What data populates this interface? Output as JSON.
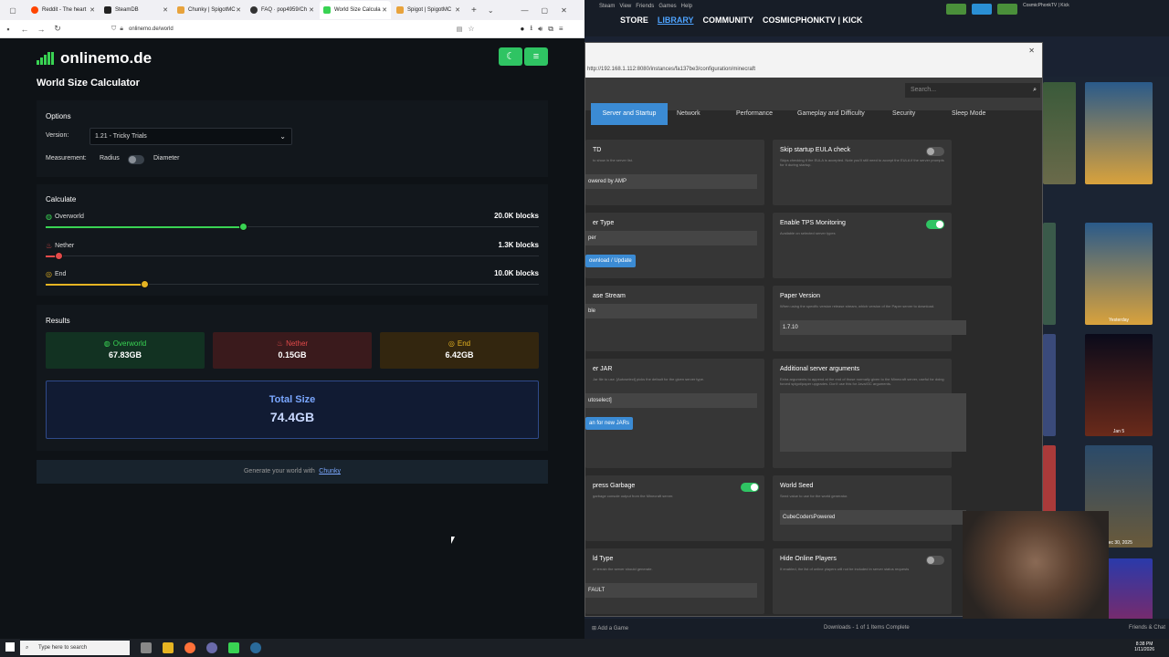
{
  "browser": {
    "tabs": [
      {
        "label": "Reddit - The heart",
        "color": "#ff4500"
      },
      {
        "label": "SteamDB",
        "color": "#222222"
      },
      {
        "label": "Chunky | SpigotMC",
        "color": "#e8a33c"
      },
      {
        "label": "FAQ · pop4959/Ch",
        "color": "#333333"
      },
      {
        "label": "World Size Calcula",
        "color": "#39d353"
      },
      {
        "label": "Spigot | SpigotMC",
        "color": "#e8a33c"
      }
    ],
    "url": "onlinemo.de/world"
  },
  "site": {
    "logo_text": "onlinemo.de",
    "page_title": "World Size Calculator",
    "moon_icon": "moon-icon",
    "menu_icon": "menu-icon"
  },
  "options": {
    "heading": "Options",
    "version_label": "Version:",
    "version_value": "1.21 - Tricky Trials",
    "measurement_label": "Measurement:",
    "radius_label": "Radius",
    "diameter_label": "Diameter"
  },
  "calculate": {
    "heading": "Calculate",
    "sliders": [
      {
        "label": "Overworld",
        "value": "20.0K blocks",
        "level": 0.4,
        "color": "#39d353",
        "icon": "globe-icon"
      },
      {
        "label": "Nether",
        "value": "1.3K blocks",
        "level": 0.025,
        "color": "#e34a4a",
        "icon": "flame-icon"
      },
      {
        "label": "End",
        "value": "10.0K blocks",
        "level": 0.2,
        "color": "#e6b422",
        "icon": "end-icon"
      }
    ]
  },
  "results": {
    "heading": "Results",
    "items": [
      {
        "label": "Overworld",
        "value": "67.83GB",
        "color": "#39d353",
        "bg": "#123222",
        "icon": "globe-icon"
      },
      {
        "label": "Nether",
        "value": "0.15GB",
        "color": "#e34a4a",
        "bg": "#3a1a1c",
        "icon": "flame-icon"
      },
      {
        "label": "End",
        "value": "6.42GB",
        "color": "#e6b422",
        "bg": "#33260f",
        "icon": "end-icon"
      }
    ],
    "total_label": "Total Size",
    "total_value": "74.4GB"
  },
  "footer": {
    "text": "Generate your world with",
    "link": "Chunky"
  },
  "taskbar": {
    "search_placeholder": "Type here to search",
    "time": "8:38 PM",
    "date": "1/11/2026"
  },
  "steam": {
    "menu": [
      "Steam",
      "View",
      "Friends",
      "Games",
      "Help"
    ],
    "nav": [
      "STORE",
      "LIBRARY",
      "COMMUNITY",
      "COSMICPHONKTV | KICK"
    ],
    "user": "CosmicPhonkTV | Kick",
    "search_placeholder": "Search...",
    "add_game": "Add a Game",
    "downloads": "Downloads - 1 of 1 Items Complete",
    "friends_chat": "Friends & Chat",
    "captions": [
      "Yesterday",
      "Jan 5",
      "Dec 30, 2025"
    ]
  },
  "amp": {
    "url": "http://192.168.1.112:8080/instances/fa137be3/configuration/minecraft",
    "tabs": [
      "Server and Startup",
      "Network",
      "Performance",
      "Gameplay and Difficulty",
      "Security",
      "Sleep Mode"
    ],
    "cards": [
      {
        "title": "TD",
        "desc": "to show in the server list.",
        "input": "owered by AMP"
      },
      {
        "title": "Skip startup EULA check",
        "desc": "Skips checking if the EULA is accepted. Note you'll still need to accept the EULA if the server prompts for it during startup."
      },
      {
        "title": "er Type",
        "input": "per"
      },
      {
        "title": "Enable TPS Monitoring",
        "desc": "Available on selected server types"
      },
      {
        "title": "ase Stream",
        "input": "ble"
      },
      {
        "title": "Paper Version",
        "desc": "When using the specific version release stream, which version of the Paper server to download.",
        "input": "1.7.10"
      },
      {
        "title": "er JAR",
        "desc": "Jar file to use. [Autoselect] picks the default for the given server type.",
        "input": "utoselect]"
      },
      {
        "title": "Additional server arguments",
        "desc": "Extra arguments to append at the end of those normally given to the Minecraft server, useful for doing forced spigot/paper upgrades. Don't use this for Java/GC arguments."
      },
      {
        "title": "press Garbage",
        "desc": "garbage console output from the Minecraft server."
      },
      {
        "title": "World Seed",
        "desc": "Seed value to use for the world generator.",
        "input": "CubeCodersPowered"
      },
      {
        "title": "ld Type",
        "desc": "of terrain the server should generate.",
        "input": "FAULT"
      },
      {
        "title": "Hide Online Players",
        "desc": "If enabled, the list of online players will not be included in server status requests"
      }
    ],
    "buttons": [
      "ownload / Update",
      "an for new JARs"
    ]
  }
}
